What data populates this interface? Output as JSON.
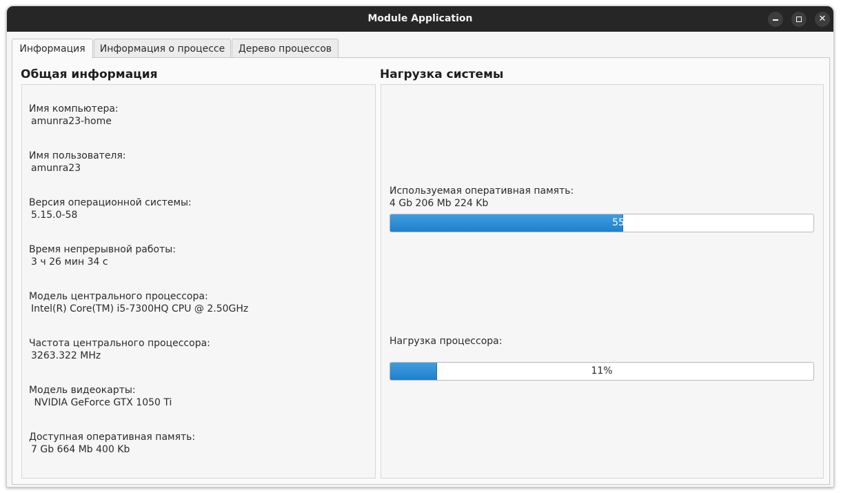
{
  "window": {
    "title": "Module Application",
    "controls": {
      "minimize": "minimize",
      "maximize": "maximize",
      "close": "✕"
    }
  },
  "tabs": [
    {
      "label": "Информация",
      "active": true
    },
    {
      "label": "Информация о процессе",
      "active": false
    },
    {
      "label": "Дерево процессов",
      "active": false
    }
  ],
  "general": {
    "title": "Общая информация",
    "items": [
      {
        "label": "Имя компьютера:",
        "value": "amunra23-home"
      },
      {
        "label": "Имя пользователя:",
        "value": "amunra23"
      },
      {
        "label": "Версия операционной системы:",
        "value": "5.15.0-58"
      },
      {
        "label": "Время непрерывной работы:",
        "value": "3 ч 26 мин 34 с"
      },
      {
        "label": "Модель центрального процессора:",
        "value": "Intel(R) Core(TM) i5-7300HQ CPU @ 2.50GHz"
      },
      {
        "label": "Частота центрального процессора:",
        "value": "3263.322 MHz"
      },
      {
        "label": "Модель видеокарты:",
        "value": " NVIDIA GeForce GTX 1050 Ti"
      },
      {
        "label": "Доступная оперативная память:",
        "value": "7 Gb 664 Mb 400 Kb"
      }
    ]
  },
  "system_load": {
    "title": "Нагрузка системы",
    "memory": {
      "label": "Используемая оперативная память:",
      "value": "4 Gb 206 Mb 224 Kb",
      "percent": 55,
      "percent_text": "55%"
    },
    "cpu": {
      "label": "Нагрузка процессора:",
      "percent": 11,
      "percent_text": "11%"
    }
  },
  "colors": {
    "accent": "#1f7fcb",
    "titlebar": "#262626"
  }
}
